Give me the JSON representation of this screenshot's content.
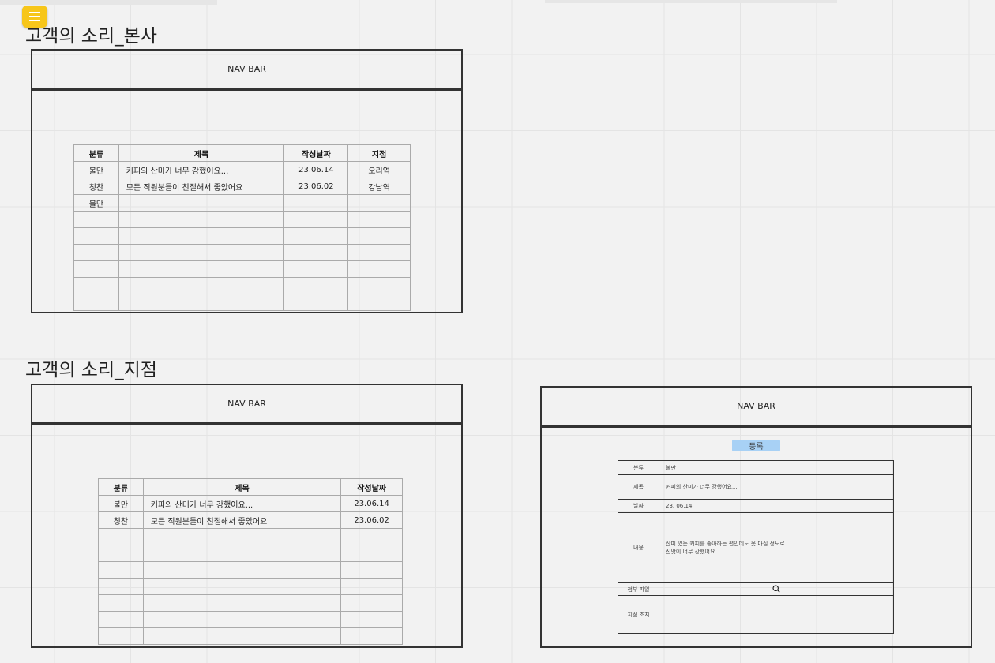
{
  "top_menu_icon": "menu-icon",
  "sections": {
    "hq": {
      "title": "고객의 소리_본사",
      "navbar": "NAV BAR"
    },
    "branch": {
      "title": "고객의 소리_지점",
      "navbar": "NAV BAR"
    },
    "detail": {
      "navbar": "NAV BAR"
    }
  },
  "hq_table": {
    "headers": [
      "분류",
      "제목",
      "작성날짜",
      "지점"
    ],
    "rows": [
      [
        "불만",
        "커피의 산미가 너무 강했어요...",
        "23.06.14",
        "오리역"
      ],
      [
        "칭찬",
        "모든 직원분들이 친절해서 좋았어요",
        "23.06.02",
        "강남역"
      ],
      [
        "불만",
        "",
        "",
        ""
      ]
    ]
  },
  "branch_table": {
    "headers": [
      "분류",
      "제목",
      "작성날짜"
    ],
    "rows": [
      [
        "불만",
        "커피의 산미가 너무 강했어요...",
        "23.06.14"
      ],
      [
        "칭찬",
        "모든 직원분들이 친절해서 좋았어요",
        "23.06.02"
      ]
    ]
  },
  "detail_form": {
    "register_button": "등록",
    "category_label": "분류",
    "category_value": "불만",
    "title_label": "제목",
    "title_value": "커피의 산미가 너무 강했어요...",
    "date_label": "날짜",
    "date_value": "23. 06.14",
    "content_label": "내용",
    "content_line1": "산미 있는 커피를 좋아하는 편인데도 못 마실 정도로",
    "content_line2": "신맛이 너무 강했어요",
    "attachment_label": "첨부 파일",
    "attachment_icon": "search-icon",
    "action_label": "지점 조치",
    "action_value": ""
  }
}
